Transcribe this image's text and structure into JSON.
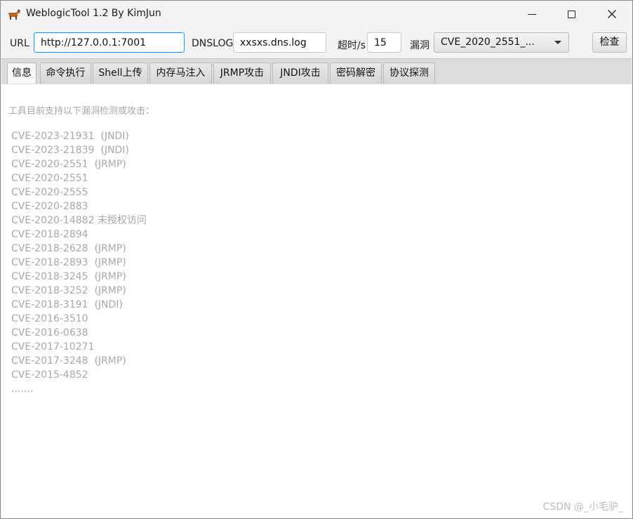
{
  "window": {
    "title": "WeblogicTool 1.2 By KimJun",
    "icon": "horse-app-icon"
  },
  "toolbar": {
    "url_label": "URL",
    "url_value": "http://127.0.0.1:7001",
    "dnslog_label": "DNSLOG",
    "dnslog_value": "xxsxs.dns.log",
    "timeout_label": "超时/s",
    "timeout_value": "15",
    "vuln_label": "漏洞",
    "vuln_selected": "CVE_2020_2551_...",
    "check_button": "检查"
  },
  "tabs": [
    {
      "label": "信息",
      "active": true
    },
    {
      "label": "命令执行"
    },
    {
      "label": "Shell上传"
    },
    {
      "label": "内存马注入"
    },
    {
      "label": "JRMP攻击"
    },
    {
      "label": "JNDI攻击"
    },
    {
      "label": "密码解密"
    },
    {
      "label": "协议探测"
    }
  ],
  "content": {
    "intro": "工具目前支持以下漏洞检测或攻击：",
    "cves": [
      "CVE-2023-21931  (JNDI)",
      "CVE-2023-21839  (JNDI)",
      "CVE-2020-2551  (JRMP)",
      "CVE-2020-2551",
      "CVE-2020-2555",
      "CVE-2020-2883",
      "CVE-2020-14882 未授权访问",
      "CVE-2018-2894",
      "CVE-2018-2628  (JRMP)",
      "CVE-2018-2893  (JRMP)",
      "CVE-2018-3245  (JRMP)",
      "CVE-2018-3252  (JRMP)",
      "CVE-2018-3191  (JNDI)",
      "CVE-2016-3510",
      "CVE-2016-0638",
      "CVE-2017-10271",
      "CVE-2017-3248  (JRMP)",
      "CVE-2015-4852",
      "......."
    ],
    "watermark": "CSDN @_小毛驴_"
  },
  "colors": {
    "accent_focus": "#3b8edb",
    "muted_text": "#a8a8a8"
  }
}
